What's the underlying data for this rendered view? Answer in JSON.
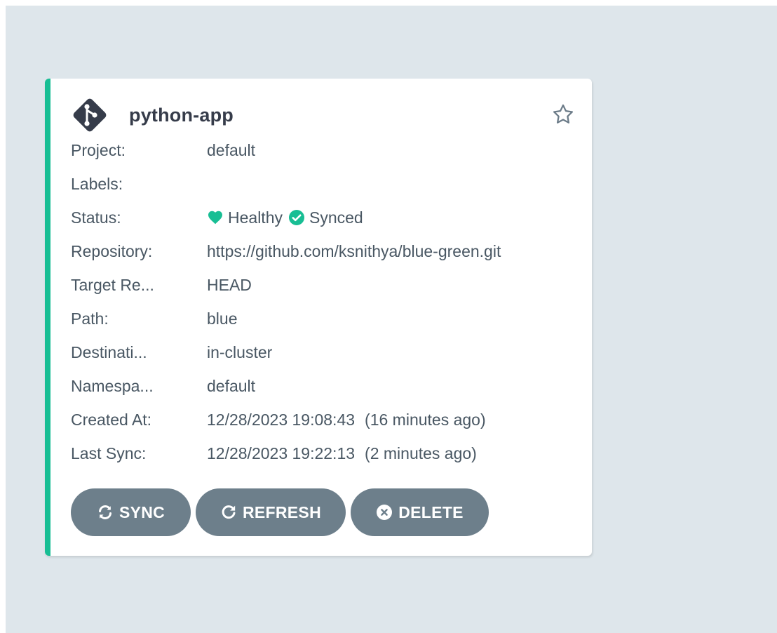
{
  "app": {
    "name": "python-app",
    "logo_icon": "git-diamond-icon",
    "favorite_icon": "star-outline-icon"
  },
  "fields": {
    "project_label": "Project:",
    "project_value": "default",
    "labels_label": "Labels:",
    "labels_value": "",
    "status_label": "Status:",
    "health_text": "Healthy",
    "sync_text": "Synced",
    "repo_label": "Repository:",
    "repo_value": "https://github.com/ksnithya/blue-green.git",
    "target_label": "Target Re...",
    "target_value": "HEAD",
    "path_label": "Path:",
    "path_value": "blue",
    "dest_label": "Destinati...",
    "dest_value": "in-cluster",
    "ns_label": "Namespa...",
    "ns_value": "default",
    "created_label": "Created At:",
    "created_value": "12/28/2023 19:08:43",
    "created_ago": "(16 minutes ago)",
    "lastsync_label": "Last Sync:",
    "lastsync_value": "12/28/2023 19:22:13",
    "lastsync_ago": "(2 minutes ago)"
  },
  "actions": {
    "sync_label": "SYNC",
    "refresh_label": "REFRESH",
    "delete_label": "DELETE"
  },
  "colors": {
    "accent": "#18be94",
    "button_bg": "#6d7f8b",
    "text": "#495763",
    "background": "#dee6eb"
  }
}
